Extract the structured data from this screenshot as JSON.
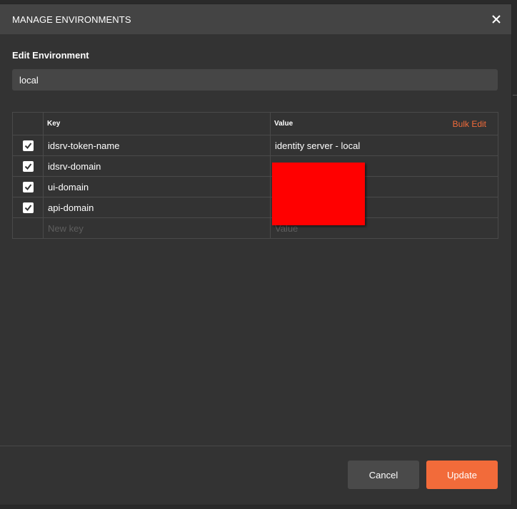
{
  "modal": {
    "title": "MANAGE ENVIRONMENTS",
    "section_label": "Edit Environment",
    "environment_name": "local"
  },
  "table": {
    "headers": {
      "key": "Key",
      "value": "Value",
      "bulk_edit": "Bulk Edit"
    },
    "rows": [
      {
        "checked": true,
        "key": "idsrv-token-name",
        "value": "identity server - local"
      },
      {
        "checked": true,
        "key": "idsrv-domain",
        "value": ""
      },
      {
        "checked": true,
        "key": "ui-domain",
        "value": ""
      },
      {
        "checked": true,
        "key": "api-domain",
        "value": ""
      }
    ],
    "new_row": {
      "key_placeholder": "New key",
      "value_placeholder": "Value"
    }
  },
  "footer": {
    "cancel_label": "Cancel",
    "update_label": "Update"
  },
  "colors": {
    "accent": "#f26b3a",
    "redaction": "#ff0000",
    "background": "#333333",
    "header": "#444444"
  },
  "icons": {
    "close": "close-icon",
    "check": "checkmark-icon"
  }
}
